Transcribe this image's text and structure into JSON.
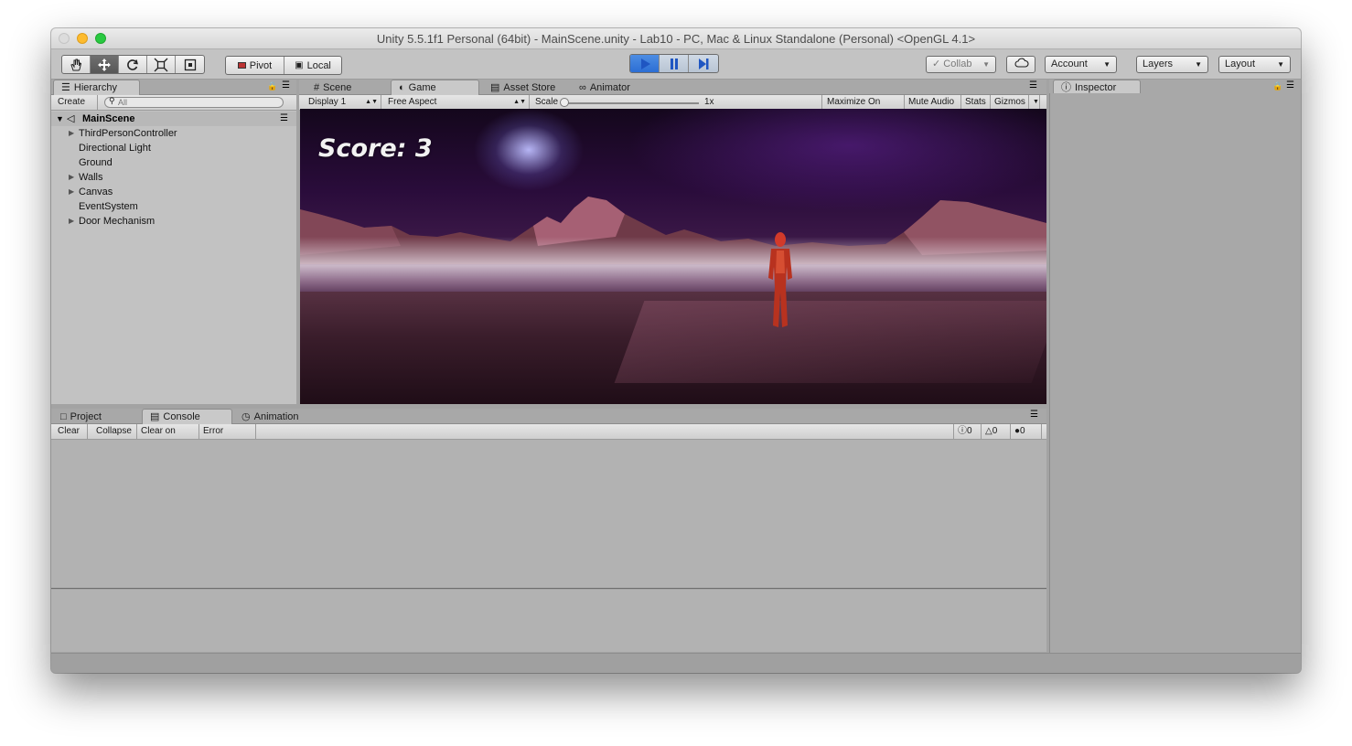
{
  "window": {
    "title": "Unity 5.5.1f1 Personal (64bit) - MainScene.unity - Lab10 - PC, Mac & Linux Standalone (Personal) <OpenGL 4.1>"
  },
  "toolbar": {
    "pivot_label": "Pivot",
    "local_label": "Local",
    "collab_label": "Collab",
    "account_label": "Account",
    "layers_label": "Layers",
    "layout_label": "Layout"
  },
  "hierarchy": {
    "tab_label": "Hierarchy",
    "create_label": "Create",
    "search_placeholder": "All",
    "scene_name": "MainScene",
    "items": [
      {
        "label": "ThirdPersonController",
        "expandable": true
      },
      {
        "label": "Directional Light",
        "expandable": false
      },
      {
        "label": "Ground",
        "expandable": false
      },
      {
        "label": "Walls",
        "expandable": true
      },
      {
        "label": "Canvas",
        "expandable": true
      },
      {
        "label": "EventSystem",
        "expandable": false
      },
      {
        "label": "Door Mechanism",
        "expandable": true
      }
    ]
  },
  "center_tabs": {
    "scene": "Scene",
    "game": "Game",
    "asset_store": "Asset Store",
    "animator": "Animator"
  },
  "game_toolbar": {
    "display": "Display 1",
    "aspect": "Free Aspect",
    "scale_label": "Scale",
    "scale_value": "1x",
    "maximize": "Maximize On Play",
    "mute": "Mute Audio",
    "stats": "Stats",
    "gizmos": "Gizmos"
  },
  "game": {
    "score_text": "Score: 3"
  },
  "bottom_tabs": {
    "project": "Project",
    "console": "Console",
    "animation": "Animation"
  },
  "console_toolbar": {
    "clear": "Clear",
    "collapse": "Collapse",
    "clear_on_play": "Clear on Play",
    "error_pause": "Error Pause",
    "info_count": "0",
    "warning_count": "0",
    "error_count": "0"
  },
  "inspector": {
    "tab_label": "Inspector"
  },
  "colors": {
    "play_active": "#2c6ed4",
    "panel_bg": "#c2c2c2",
    "window_bg": "#a3a3a3"
  }
}
